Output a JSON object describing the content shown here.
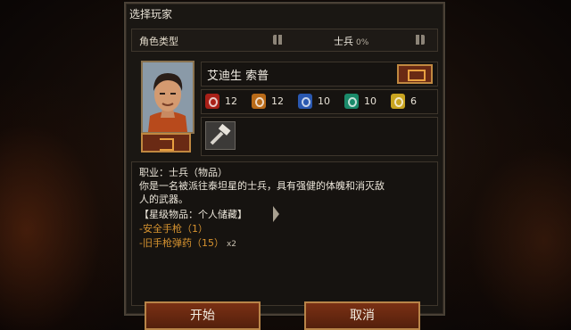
{
  "dialog": {
    "title": "选择玩家",
    "character_type": {
      "label": "角色类型",
      "value": "士兵",
      "percent": "0%"
    },
    "character_name": "艾迪生 索普",
    "stats": [
      {
        "icon": "fist-strength-icon",
        "value": "12",
        "color": "#a82018"
      },
      {
        "icon": "shield-defense-icon",
        "value": "12",
        "color": "#b86a18"
      },
      {
        "icon": "boot-speed-icon",
        "value": "10",
        "color": "#2a58b0"
      },
      {
        "icon": "eye-perception-icon",
        "value": "10",
        "color": "#1a8a6a"
      },
      {
        "icon": "skill-tech-icon",
        "value": "6",
        "color": "#c8a420"
      }
    ],
    "description": {
      "line1": "职业：士兵（物品）",
      "line2": "你是一名被派往泰坦星的士兵，具有强健的体魄和消灭敌",
      "line3": "人的武器。",
      "section_header": "【星级物品：个人储藏】",
      "items": [
        {
          "label": "-安全手枪（1）",
          "qty": ""
        },
        {
          "label": "-旧手枪弹药（15）",
          "qty": "x2"
        }
      ]
    }
  },
  "buttons": {
    "start": "开始",
    "cancel": "取消"
  }
}
